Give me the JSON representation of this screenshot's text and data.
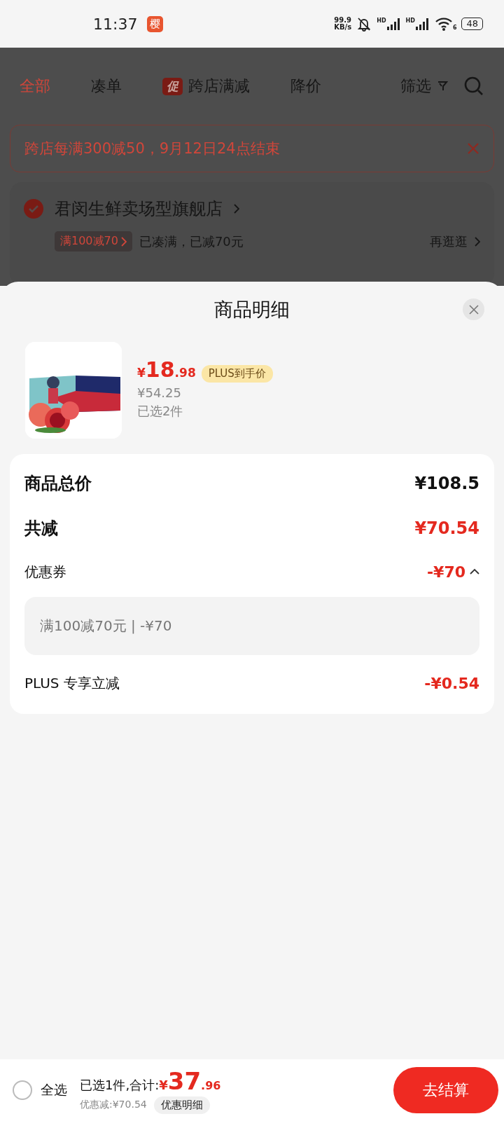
{
  "status_bar": {
    "time": "11:37",
    "app_badge": "樱",
    "net_speed": "99.9",
    "net_unit": "KB/s",
    "hd_labels": [
      "HD",
      "HD"
    ],
    "wifi_label": "6",
    "battery": "48"
  },
  "background_page": {
    "tabs": [
      {
        "label": "全部",
        "selected": true
      },
      {
        "label": "凑单",
        "selected": false
      },
      {
        "label": "跨店满减",
        "selected": false,
        "badge": "促"
      },
      {
        "label": "降价",
        "selected": false
      }
    ],
    "filter": "筛选",
    "banner": "跨店每满300减50，9月12日24点结束",
    "store": {
      "name": "君闵生鲜卖场型旗舰店",
      "checked": true,
      "promo_tag": "满100减70",
      "promo_status": "已凑满，已减70元",
      "more_link": "再逛逛"
    }
  },
  "sheet": {
    "title": "商品明细",
    "product": {
      "kind": "picture",
      "currency": "¥",
      "price_int": "18",
      "price_dec": ".98",
      "price_tag": "PLUS到手价",
      "original_price": "¥54.25",
      "quantity": "已选2件"
    },
    "rows": [
      {
        "kind": "total",
        "label": "商品总价",
        "value": "¥108.5",
        "color": "#111111"
      },
      {
        "kind": "total",
        "label": "共减",
        "value": "¥70.54",
        "color": "#e4291f"
      },
      {
        "kind": "expandable",
        "label": "优惠券",
        "value": "-¥70",
        "color": "#e4291f",
        "expanded": true,
        "detail": "满100减70元 | -¥70"
      },
      {
        "kind": "line",
        "label": "PLUS 专享立减",
        "value": "-¥0.54",
        "color": "#e4291f"
      }
    ]
  },
  "bottom_bar": {
    "select_all": {
      "label": "全选",
      "checked": false
    },
    "summary": "已选1件,合计:",
    "currency": "¥",
    "total_int": "37",
    "total_dec": ".96",
    "saved": "优惠减:¥70.54",
    "details_button": "优惠明细",
    "checkout_button": "去结算"
  }
}
